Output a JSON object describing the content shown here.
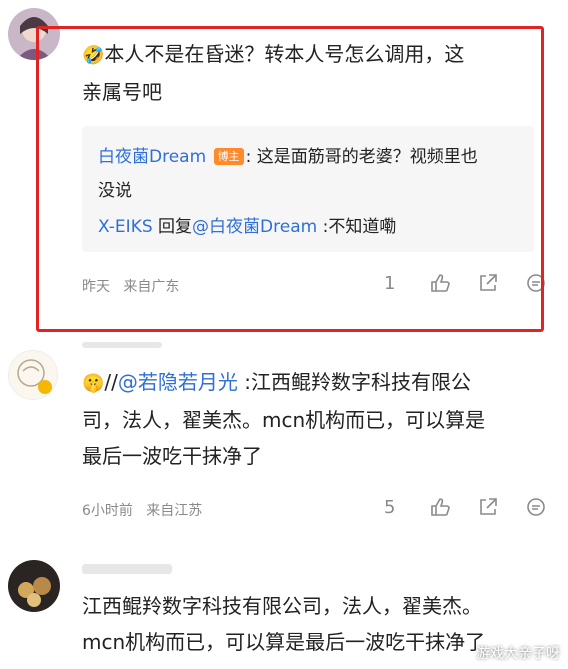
{
  "comments": [
    {
      "emoji": "🤣",
      "text_line1": "本人不是在昏迷？转本人号怎么调用，这",
      "text_line2": "亲属号吧",
      "replies": [
        {
          "author": "白夜菌Dream",
          "badge": "博主",
          "text_part1": ": 这是面筋哥的老婆？视频里也",
          "text_part2": "没说"
        },
        {
          "author": "X-EIKS",
          "reply_word": " 回复",
          "mention": "@白夜菌Dream",
          "text": " :不知道嘞"
        }
      ],
      "time": "昨天",
      "location": "来自广东",
      "like_count": "1"
    },
    {
      "emoji": "🤫",
      "prefix": "//",
      "mention": "@若隐若月光",
      "text_line1_rest": " :江西鲲羚数字科技有限公",
      "text_line2": "司，法人，翟美杰。mcn机构而已，可以算是",
      "text_line3": "最后一波吃干抹净了",
      "time": "6小时前",
      "location": "来自江苏",
      "like_count": "5"
    },
    {
      "text_line1": "江西鲲羚数字科技有限公司，法人，翟美杰。",
      "text_line2": "mcn机构而已，可以算是最后一波吃干抹净了"
    }
  ],
  "watermark": "游戏大亲子呀",
  "icons": [
    "thumb-up-icon",
    "share-icon",
    "comment-icon"
  ]
}
